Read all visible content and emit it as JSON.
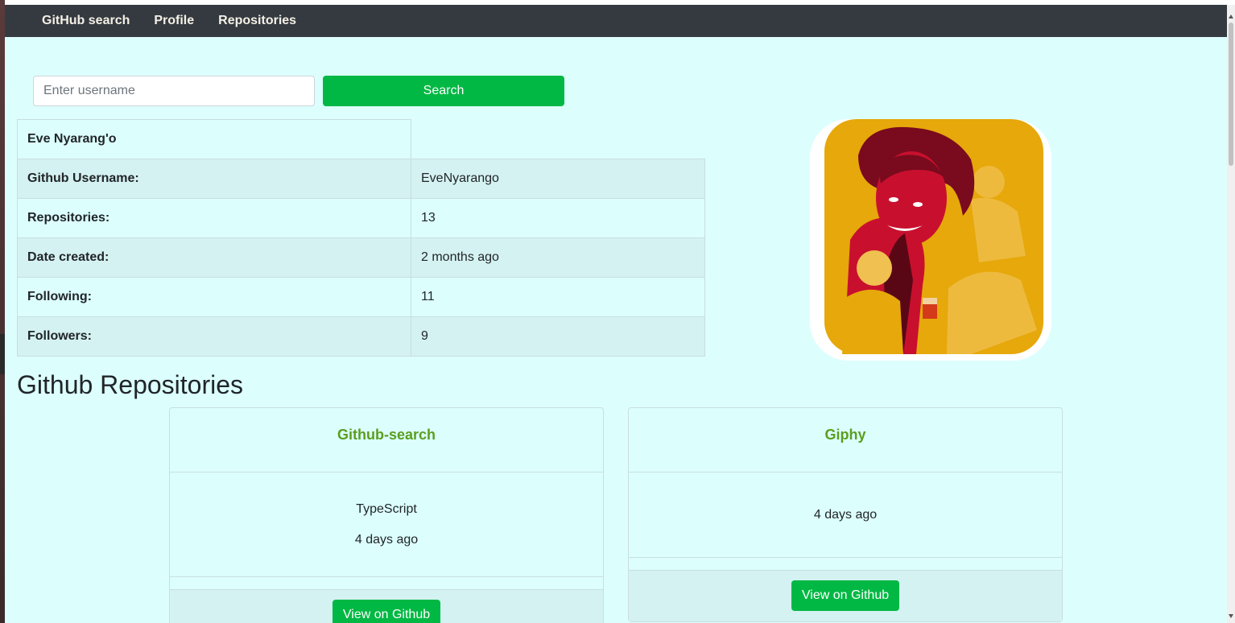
{
  "nav": {
    "brand": "GitHub search",
    "profile": "Profile",
    "repositories": "Repositories"
  },
  "search": {
    "placeholder": "Enter username",
    "button": "Search"
  },
  "profile": {
    "name": "Eve Nyarang'o",
    "rows": [
      {
        "label": "Github Username:",
        "value": "EveNyarango"
      },
      {
        "label": "Repositories:",
        "value": "13"
      },
      {
        "label": "Date created:",
        "value": "2 months ago"
      },
      {
        "label": "Following:",
        "value": "11"
      },
      {
        "label": "Followers:",
        "value": "9"
      }
    ]
  },
  "repos_section": {
    "title": "Github Repositories"
  },
  "repos": [
    {
      "name": "Github-search",
      "language": "TypeScript",
      "updated": "4 days ago",
      "button": "View on Github"
    },
    {
      "name": "Giphy",
      "language": "",
      "updated": "4 days ago",
      "button": "View on Github"
    }
  ],
  "colors": {
    "page_bg": "#dcfffe",
    "nav_bg": "#343a40",
    "accent_green": "#00b843",
    "repo_title": "#5b9e1e"
  }
}
